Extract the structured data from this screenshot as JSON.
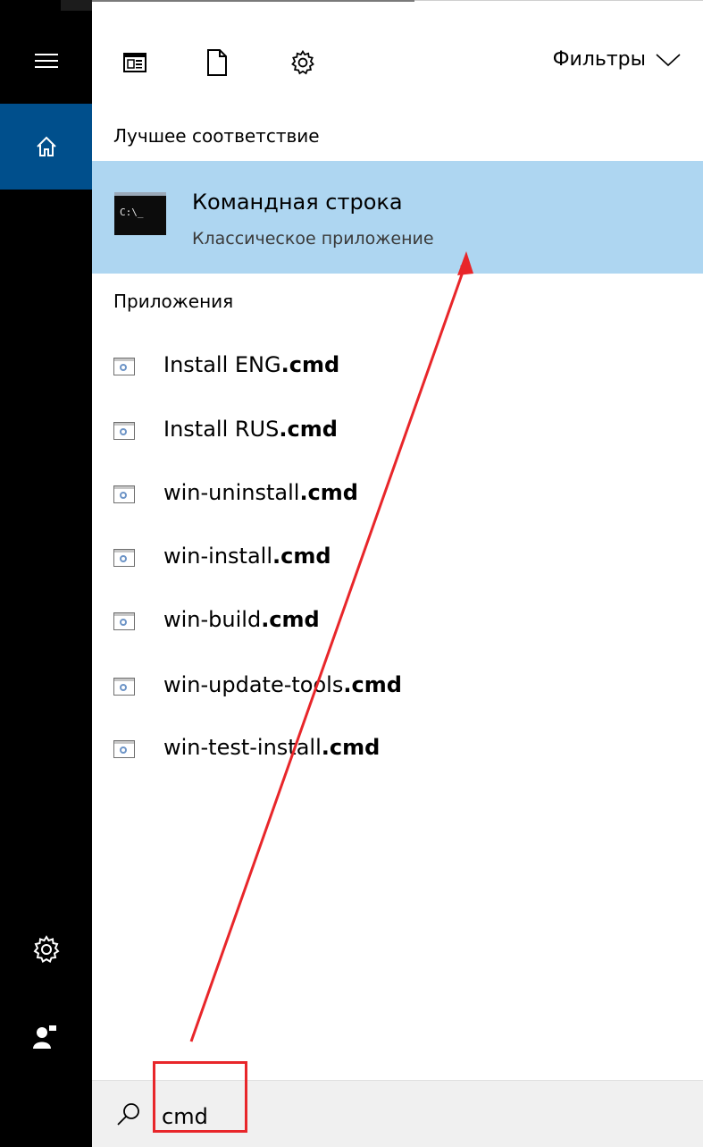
{
  "toolbar": {
    "apps_icon": "apps-icon",
    "docs_icon": "document-icon",
    "web_icon": "gear-icon",
    "filters_label": "Фильтры",
    "filters_icon": "chevron-down-icon"
  },
  "rail": {
    "menu_icon": "hamburger-icon",
    "home_icon": "home-icon",
    "settings_icon": "gear-icon",
    "user_icon": "user-icon",
    "active_color": "#004f8c"
  },
  "best_match": {
    "header": "Лучшее соответствие",
    "title": "Командная строка",
    "subtitle": "Классическое приложение",
    "icon_text": "C:\\_",
    "highlight_color": "#aed6f1"
  },
  "apps": {
    "header": "Приложения",
    "items": [
      {
        "prefix": "Install ENG",
        "match": ".cmd"
      },
      {
        "prefix": "Install RUS",
        "match": ".cmd"
      },
      {
        "prefix": "win-uninstall",
        "match": ".cmd"
      },
      {
        "prefix": "win-install",
        "match": ".cmd"
      },
      {
        "prefix": "win-build",
        "match": ".cmd"
      },
      {
        "prefix": "win-update-tools",
        "match": ".cmd"
      },
      {
        "prefix": "win-test-install",
        "match": ".cmd"
      }
    ]
  },
  "search": {
    "value": "cmd",
    "icon": "search-icon"
  },
  "annotation": {
    "color": "#e8262a"
  }
}
